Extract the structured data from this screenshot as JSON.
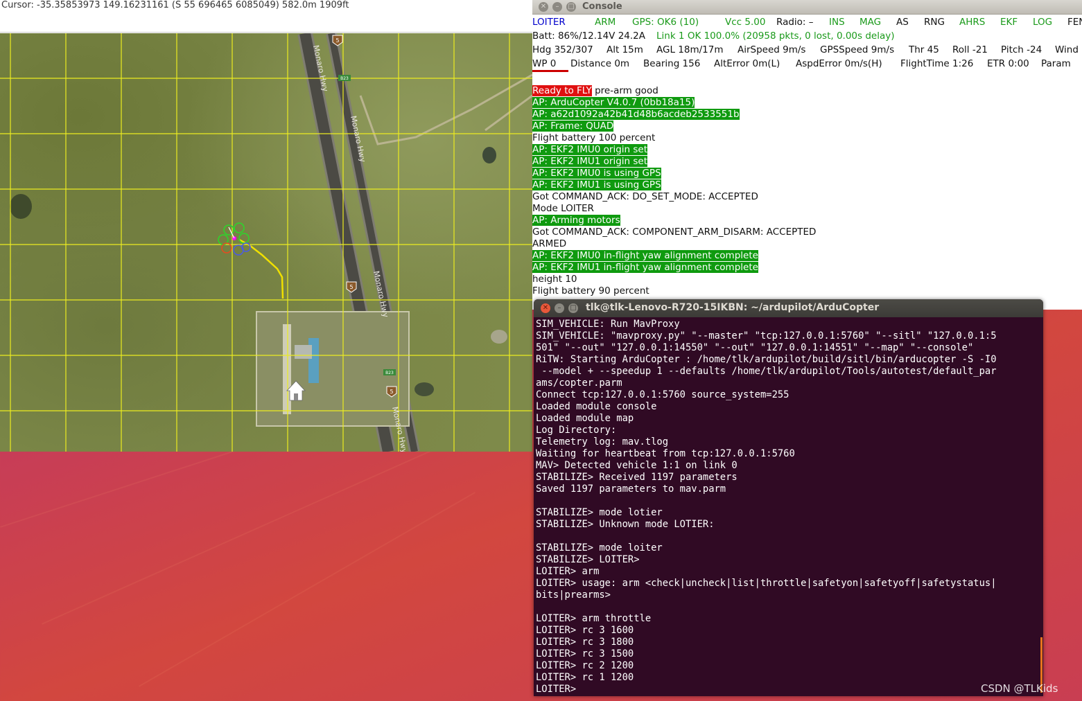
{
  "map": {
    "cursor_text": "Cursor: -35.35853973 149.16231161 (S 55 696465 6085049) 582.0m 1909ft",
    "road_labels": [
      "Monaro Hwy",
      "Monaro Hwy",
      "Monaro Hwy",
      "Monaro Hwy"
    ],
    "shield_labels": [
      "5",
      "5",
      "5"
    ],
    "route_tags": [
      "B23",
      "B23"
    ],
    "home_icon": "home-icon"
  },
  "console": {
    "title": "Console",
    "status_row1": {
      "mode": "LOITER",
      "arm": "ARM",
      "gps": "GPS: OK6 (10)",
      "vcc": "Vcc 5.00",
      "radio": "Radio: –",
      "ins": "INS",
      "mag": "MAG",
      "as": "AS",
      "rng": "RNG",
      "ahrs": "AHRS",
      "ekf": "EKF",
      "log": "LOG",
      "fen": "FEN"
    },
    "status_row2": {
      "batt": "Batt: 86%/12.14V 24.2A",
      "link": "Link 1 OK 100.0% (20958 pkts, 0 lost, 0.00s delay)"
    },
    "status_row3": {
      "hdg": "Hdg 352/307",
      "alt": "Alt 15m",
      "agl": "AGL 18m/17m",
      "airspeed": "AirSpeed 9m/s",
      "gpsspeed": "GPSSpeed 9m/s",
      "thr": "Thr 45",
      "roll": "Roll -21",
      "pitch": "Pitch -24",
      "wind": "Wind"
    },
    "status_row4": {
      "wp": "WP 0",
      "distance": "Distance 0m",
      "bearing": "Bearing 156",
      "alterror": "AltError 0m(L)",
      "aspderror": "AspdError 0m/s(H)",
      "flighttime": "FlightTime 1:26",
      "etr": "ETR 0:00",
      "param": "Param"
    },
    "ready_label": "Ready to FLY",
    "ready_suffix": " pre-arm good",
    "log": [
      {
        "text": "AP: ArduCopter V4.0.7 (0bb18a15)",
        "style": "green"
      },
      {
        "text": "AP: a62d1092a42b41d48b6acdeb2533551b",
        "style": "green"
      },
      {
        "text": "AP: Frame: QUAD",
        "style": "green"
      },
      {
        "text": "Flight battery 100 percent",
        "style": "plain"
      },
      {
        "text": "AP: EKF2 IMU0 origin set",
        "style": "green"
      },
      {
        "text": "AP: EKF2 IMU1 origin set",
        "style": "green"
      },
      {
        "text": "AP: EKF2 IMU0 is using GPS",
        "style": "green"
      },
      {
        "text": "AP: EKF2 IMU1 is using GPS",
        "style": "green"
      },
      {
        "text": "Got COMMAND_ACK: DO_SET_MODE: ACCEPTED",
        "style": "plain"
      },
      {
        "text": "Mode LOITER",
        "style": "plain"
      },
      {
        "text": "AP: Arming motors",
        "style": "green"
      },
      {
        "text": "Got COMMAND_ACK: COMPONENT_ARM_DISARM: ACCEPTED",
        "style": "plain"
      },
      {
        "text": "ARMED",
        "style": "plain"
      },
      {
        "text": "AP: EKF2 IMU0 in-flight yaw alignment complete",
        "style": "green"
      },
      {
        "text": "AP: EKF2 IMU1 in-flight yaw alignment complete",
        "style": "green"
      },
      {
        "text": "height 10",
        "style": "plain"
      },
      {
        "text": "Flight battery 90 percent",
        "style": "plain"
      }
    ]
  },
  "terminal": {
    "title": "tlk@tlk-Lenovo-R720-15IKBN: ~/ardupilot/ArduCopter",
    "lines": [
      "SIM_VEHICLE: Run MavProxy",
      "SIM_VEHICLE: \"mavproxy.py\" \"--master\" \"tcp:127.0.0.1:5760\" \"--sitl\" \"127.0.0.1:5",
      "501\" \"--out\" \"127.0.0.1:14550\" \"--out\" \"127.0.0.1:14551\" \"--map\" \"--console\"",
      "RiTW: Starting ArduCopter : /home/tlk/ardupilot/build/sitl/bin/arducopter -S -I0",
      " --model + --speedup 1 --defaults /home/tlk/ardupilot/Tools/autotest/default_par",
      "ams/copter.parm",
      "Connect tcp:127.0.0.1:5760 source_system=255",
      "Loaded module console",
      "Loaded module map",
      "Log Directory:",
      "Telemetry log: mav.tlog",
      "Waiting for heartbeat from tcp:127.0.0.1:5760",
      "MAV> Detected vehicle 1:1 on link 0",
      "STABILIZE> Received 1197 parameters",
      "Saved 1197 parameters to mav.parm",
      "",
      "STABILIZE> mode lotier",
      "STABILIZE> Unknown mode LOTIER:",
      "",
      "STABILIZE> mode loiter",
      "STABILIZE> LOITER>",
      "LOITER> arm",
      "LOITER> usage: arm <check|uncheck|list|throttle|safetyon|safetyoff|safetystatus|",
      "bits|prearms>",
      "",
      "LOITER> arm throttle",
      "LOITER> rc 3 1600",
      "LOITER> rc 3 1800",
      "LOITER> rc 3 1500",
      "LOITER> rc 2 1200",
      "LOITER> rc 1 1200",
      "LOITER>"
    ]
  },
  "watermark": "CSDN @TLKids"
}
